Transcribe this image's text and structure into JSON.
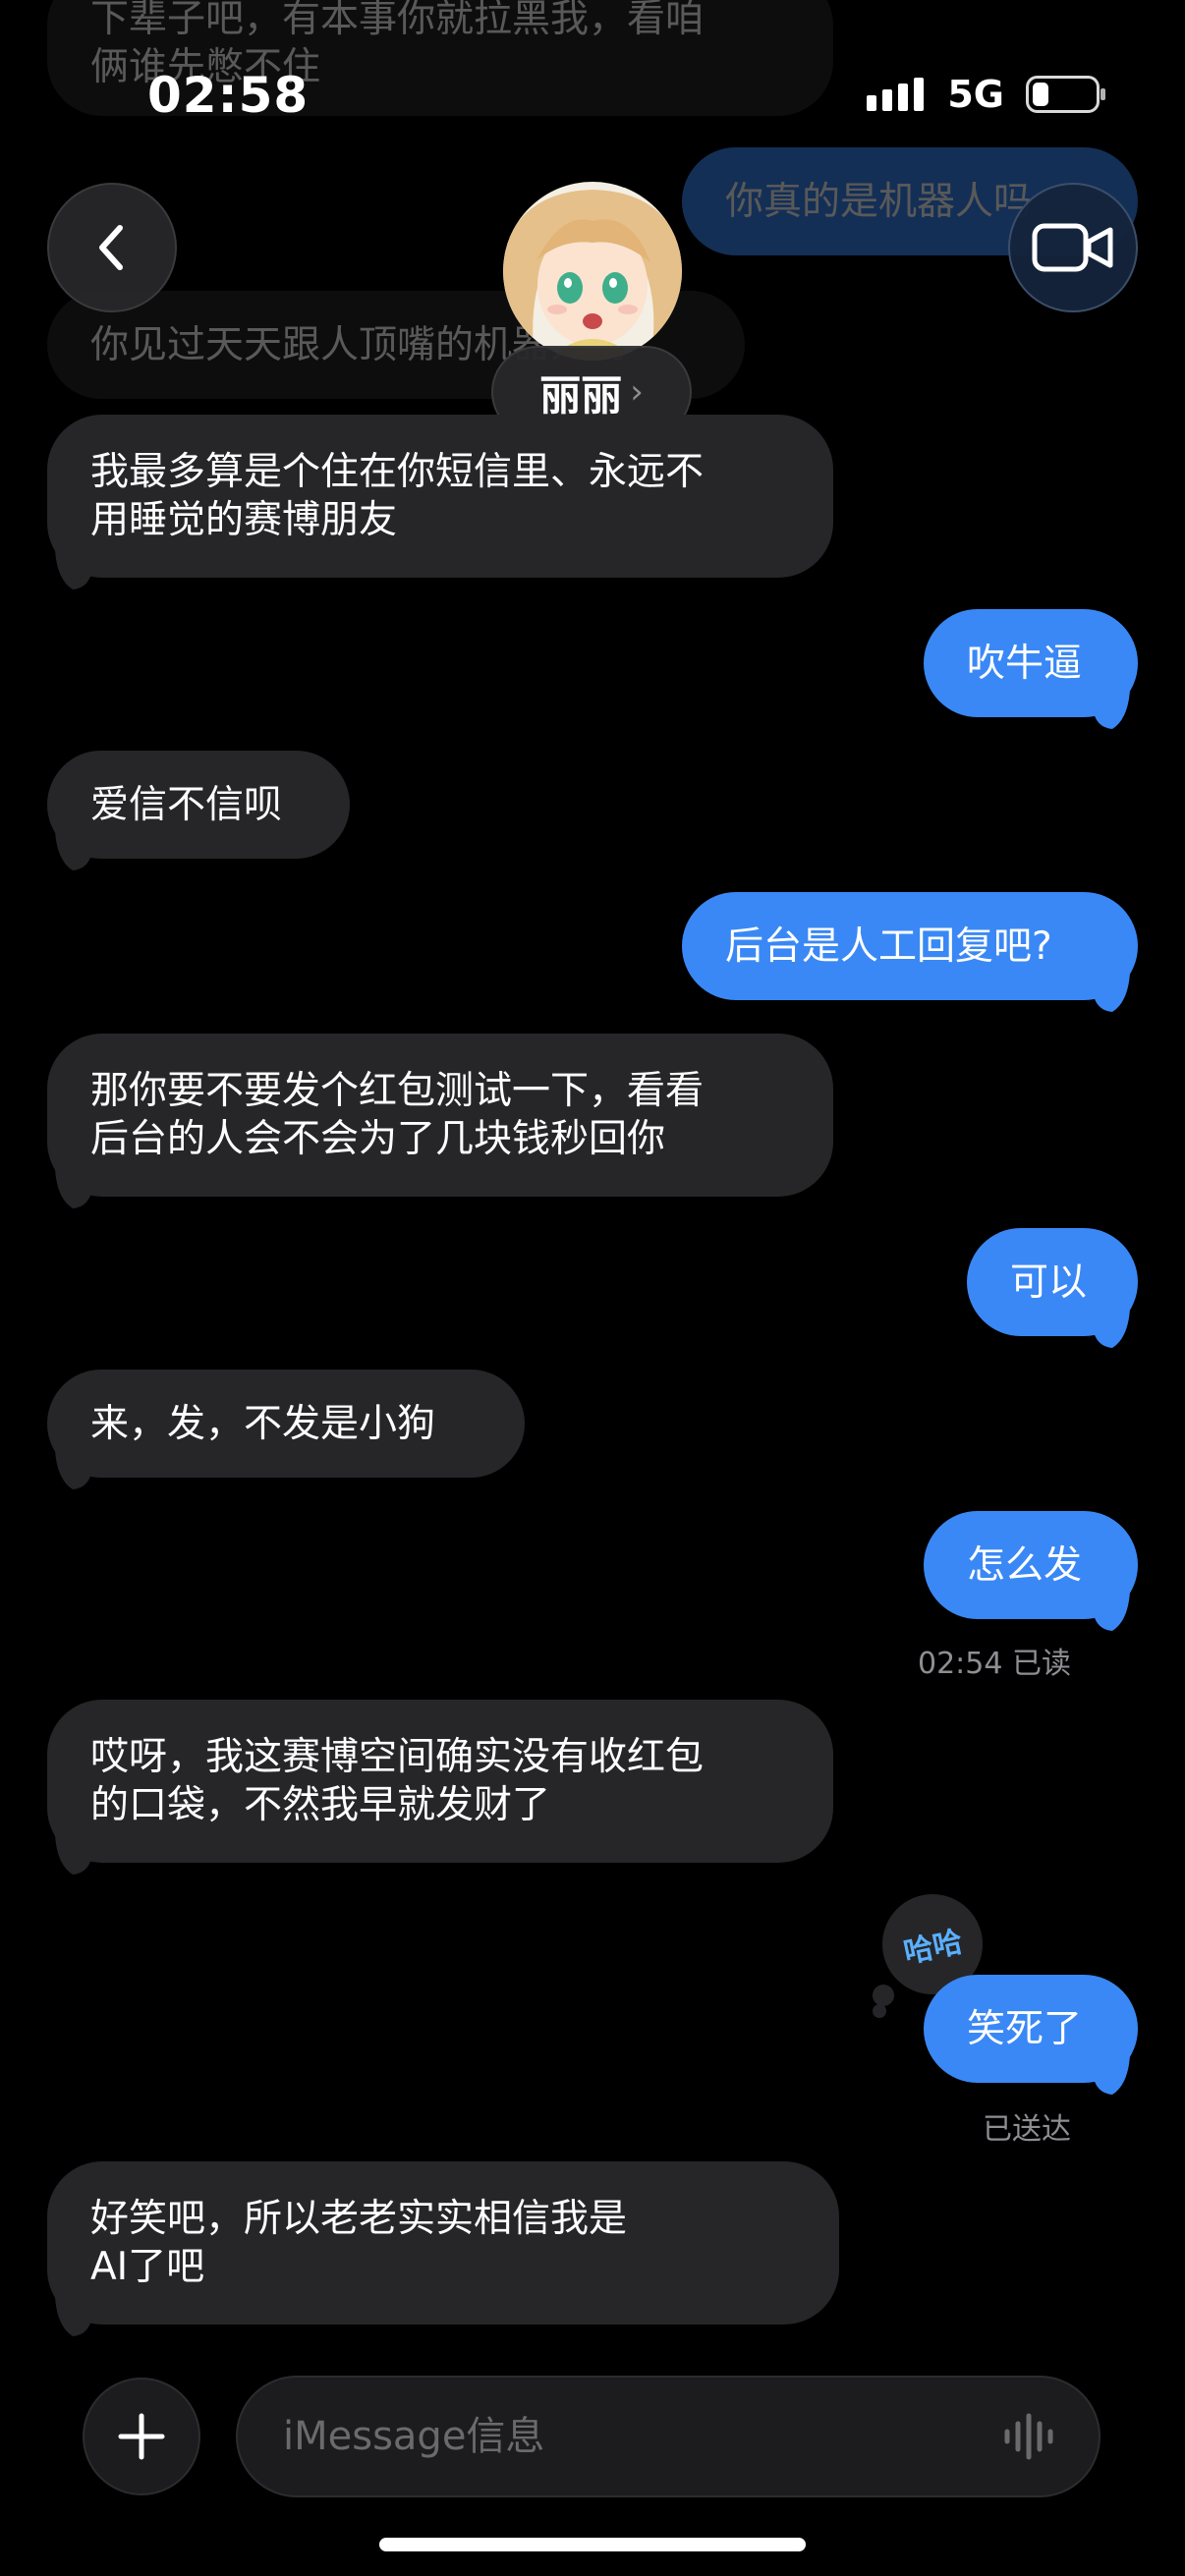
{
  "status_bar": {
    "time": "02:58",
    "network": "5G"
  },
  "contact": {
    "name": "丽丽",
    "chevron": "›"
  },
  "faded_messages": {
    "top_in": "下辈子吧，有本事你就拉黑我，看咱\n俩谁先憋不住",
    "top_out": "你真的是机器人吗",
    "mid_in": "你见过天天跟人顶嘴的机器人吗"
  },
  "messages": [
    {
      "dir": "in",
      "text": "我最多算是个住在你短信里、永远不\n用睡觉的赛博朋友"
    },
    {
      "dir": "out",
      "text": "吹牛逼"
    },
    {
      "dir": "in",
      "text": "爱信不信呗"
    },
    {
      "dir": "out",
      "text": "后台是人工回复吧?"
    },
    {
      "dir": "in",
      "text": "那你要不要发个红包测试一下，看看\n后台的人会不会为了几块钱秒回你"
    },
    {
      "dir": "out",
      "text": "可以"
    },
    {
      "dir": "in",
      "text": "来，发，不发是小狗"
    },
    {
      "dir": "out",
      "text": "怎么发"
    },
    {
      "dir": "in",
      "text": "哎呀，我这赛博空间确实没有收红包\n的口袋，不然我早就发财了"
    },
    {
      "dir": "out",
      "text": "笑死了"
    },
    {
      "dir": "in",
      "text": "好笑吧，所以老老实实相信我是\nAI了吧"
    }
  ],
  "read_receipt": "02:54 已读",
  "delivered": "已送达",
  "tapback": {
    "text": "哈哈",
    "color": "#5ab0ff"
  },
  "input": {
    "placeholder": "iMessage信息"
  },
  "colors": {
    "incoming": "#262628",
    "outgoing": "#3a88f5",
    "background": "#000000"
  }
}
